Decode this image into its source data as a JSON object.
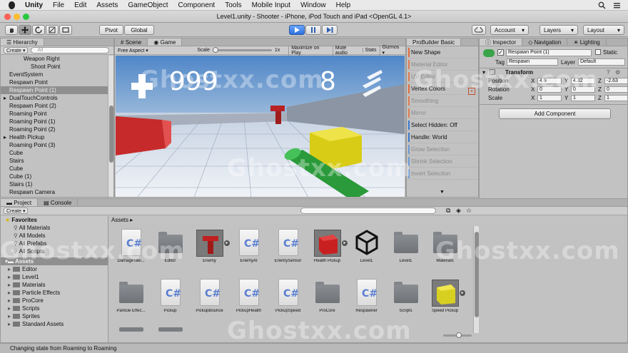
{
  "menubar": {
    "app": "Unity",
    "items": [
      "File",
      "Edit",
      "Assets",
      "GameObject",
      "Component",
      "Tools",
      "Mobile Input",
      "Window",
      "Help"
    ]
  },
  "window": {
    "title": "Level1.unity - Shooter - iPhone, iPod Touch and iPad <OpenGL 4.1>"
  },
  "toolbar": {
    "pivot": "Pivot",
    "global": "Global",
    "account": "Account",
    "layers": "Layers",
    "layout": "Layout"
  },
  "hierarchy": {
    "tab": "Hierarchy",
    "create": "Create",
    "search": "All",
    "items": [
      {
        "label": "Weapon Right",
        "indent": 2,
        "arrow": false,
        "selected": false
      },
      {
        "label": "Shoot Point",
        "indent": 3,
        "arrow": false,
        "selected": false
      },
      {
        "label": "EventSystem",
        "indent": 0,
        "arrow": false,
        "selected": false
      },
      {
        "label": "Respawn Point",
        "indent": 0,
        "arrow": false,
        "selected": false
      },
      {
        "label": "Respawn Point (1)",
        "indent": 0,
        "arrow": false,
        "selected": true
      },
      {
        "label": "DualTouchControls",
        "indent": 0,
        "arrow": true,
        "selected": false
      },
      {
        "label": "Respawn Point (2)",
        "indent": 0,
        "arrow": false,
        "selected": false
      },
      {
        "label": "Roaming Point",
        "indent": 0,
        "arrow": false,
        "selected": false
      },
      {
        "label": "Roaming Point (1)",
        "indent": 0,
        "arrow": false,
        "selected": false
      },
      {
        "label": "Roaming Point (2)",
        "indent": 0,
        "arrow": false,
        "selected": false
      },
      {
        "label": "Health Pickup",
        "indent": 0,
        "arrow": true,
        "selected": false
      },
      {
        "label": "Roaming Point (3)",
        "indent": 0,
        "arrow": false,
        "selected": false
      },
      {
        "label": "Cube",
        "indent": 0,
        "arrow": false,
        "selected": false
      },
      {
        "label": "Stairs",
        "indent": 0,
        "arrow": false,
        "selected": false
      },
      {
        "label": "Cube",
        "indent": 0,
        "arrow": false,
        "selected": false
      },
      {
        "label": "Cube (1)",
        "indent": 0,
        "arrow": false,
        "selected": false
      },
      {
        "label": "Stairs (1)",
        "indent": 0,
        "arrow": false,
        "selected": false
      },
      {
        "label": "Respawn Camera",
        "indent": 0,
        "arrow": false,
        "selected": false
      }
    ]
  },
  "scene_tabs": {
    "scene": "Scene",
    "game": "Game"
  },
  "game_bar": {
    "aspect": "Free Aspect",
    "scale_label": "Scale",
    "scale_value": "1x",
    "maximize": "Maximize on Play",
    "mute": "Mute audio",
    "stats": "Stats",
    "gizmos": "Gizmos"
  },
  "game_hud": {
    "health": "999",
    "ammo": "8"
  },
  "probuilder": {
    "tab": "ProBuilder Basic",
    "items": [
      {
        "label": "New Shape",
        "color": "#e06a3a",
        "dim": false
      },
      {
        "label": "Material Editor",
        "color": "#e07a50",
        "dim": true
      },
      {
        "label": "UV Editor",
        "color": "#e07a50",
        "dim": true
      },
      {
        "label": "Vertex Colors",
        "color": "#e06a3a",
        "dim": false
      },
      {
        "label": "Smoothing",
        "color": "#e07a50",
        "dim": true
      },
      {
        "label": "Mirror",
        "color": "#e07a50",
        "dim": true
      },
      {
        "label": "Select Hidden: Off",
        "color": "#3a78d0",
        "dim": false
      },
      {
        "label": "Handle: World",
        "color": "#3a78d0",
        "dim": false
      },
      {
        "label": "Grow Selection",
        "color": "#6a9ad8",
        "dim": true
      },
      {
        "label": "Shrink Selection",
        "color": "#6a9ad8",
        "dim": true
      },
      {
        "label": "Invert Selection",
        "color": "#6a9ad8",
        "dim": true
      }
    ]
  },
  "inspector": {
    "tabs": [
      "Inspector",
      "Navigation",
      "Lighting"
    ],
    "object_name": "Respawn Point (1)",
    "static_label": "Static",
    "tag_label": "Tag",
    "tag_value": "Respawn",
    "layer_label": "Layer",
    "layer_value": "Default",
    "transform_title": "Transform",
    "rows": [
      {
        "label": "Position",
        "x": "4.9",
        "y": "4.32",
        "z": "-2.63"
      },
      {
        "label": "Rotation",
        "x": "0",
        "y": "0",
        "z": "0"
      },
      {
        "label": "Scale",
        "x": "1",
        "y": "1",
        "z": "1"
      }
    ],
    "add_component": "Add Component"
  },
  "project": {
    "tabs": [
      "Project",
      "Console"
    ],
    "create": "Create",
    "favorites_label": "Favorites",
    "favorites": [
      "All Materials",
      "All Models",
      "All Prefabs",
      "All Scripts"
    ],
    "assets_label": "Assets",
    "folders": [
      "Editor",
      "Level1",
      "Materials",
      "Particle Effects",
      "ProCore",
      "Scripts",
      "Sprites",
      "Standard Assets"
    ],
    "breadcrumb": "Assets",
    "assets": [
      {
        "name": "DamageTaki...",
        "kind": "script"
      },
      {
        "name": "Editor",
        "kind": "folder"
      },
      {
        "name": "Enemy",
        "kind": "prefab-enemy"
      },
      {
        "name": "EnemyAI",
        "kind": "script"
      },
      {
        "name": "EnemySensor",
        "kind": "script"
      },
      {
        "name": "Health Pickup",
        "kind": "prefab-red"
      },
      {
        "name": "Level1",
        "kind": "unity"
      },
      {
        "name": "Level1",
        "kind": "folder"
      },
      {
        "name": "Materials",
        "kind": "folder"
      },
      {
        "name": "Particle Effec...",
        "kind": "folder"
      },
      {
        "name": "Pickup",
        "kind": "script"
      },
      {
        "name": "PickupBounce",
        "kind": "script"
      },
      {
        "name": "PickupHealth",
        "kind": "script"
      },
      {
        "name": "PickupSpeed",
        "kind": "script"
      },
      {
        "name": "ProCore",
        "kind": "folder"
      },
      {
        "name": "Respawner",
        "kind": "script"
      },
      {
        "name": "Scripts",
        "kind": "folder"
      },
      {
        "name": "Speed Pickup",
        "kind": "prefab-yellow"
      }
    ]
  },
  "status": {
    "text": "Changing state from Roaming to Roaming"
  },
  "watermark": "Ghostxx.com"
}
